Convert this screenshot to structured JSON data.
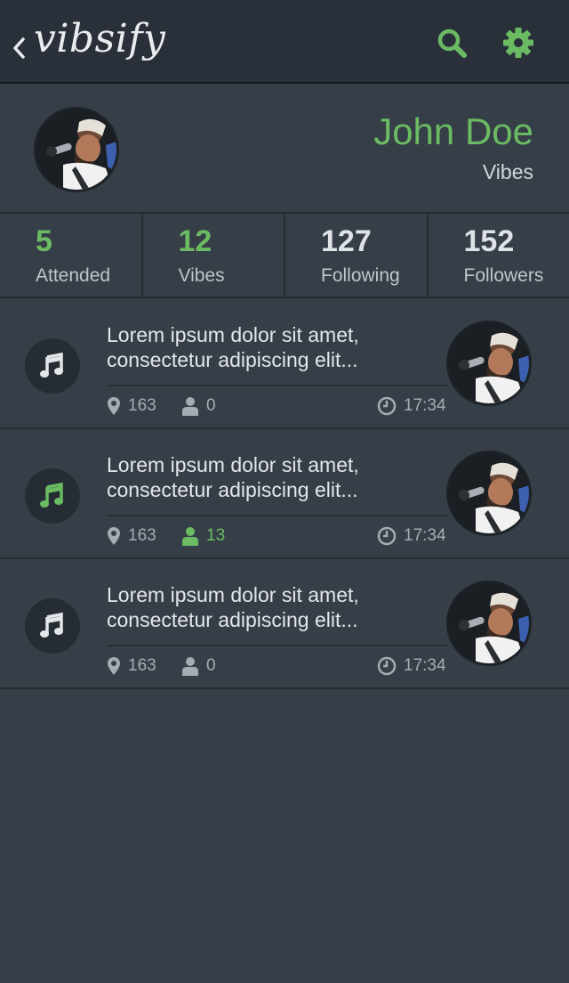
{
  "app": {
    "title": "vibsify"
  },
  "header": {
    "back_icon": "chevron-left-icon",
    "search_icon": "search-icon",
    "settings_icon": "gear-icon"
  },
  "profile": {
    "name": "John Doe",
    "subtitle": "Vibes"
  },
  "stats": [
    {
      "value": "5",
      "label": "Attended",
      "color": "#6bbb63"
    },
    {
      "value": "12",
      "label": "Vibes",
      "color": "#6bbb63"
    },
    {
      "value": "127",
      "label": "Following",
      "color": "#dfe3e7"
    },
    {
      "value": "152",
      "label": "Followers",
      "color": "#dfe3e7"
    }
  ],
  "feed": [
    {
      "text": "Lorem ipsum dolor sit amet, consectetur adipiscing elit...",
      "locations": "163",
      "people": "0",
      "time": "17:34",
      "active": false
    },
    {
      "text": "Lorem ipsum dolor sit amet, consectetur adipiscing elit...",
      "locations": "163",
      "people": "13",
      "time": "17:34",
      "active": true
    },
    {
      "text": "Lorem ipsum dolor sit amet, consectetur adipiscing elit...",
      "locations": "163",
      "people": "0",
      "time": "17:34",
      "active": false
    }
  ],
  "colors": {
    "accent": "#6bbb63",
    "background": "#363e48",
    "header": "#2a3039",
    "muted": "#a5acb4"
  }
}
